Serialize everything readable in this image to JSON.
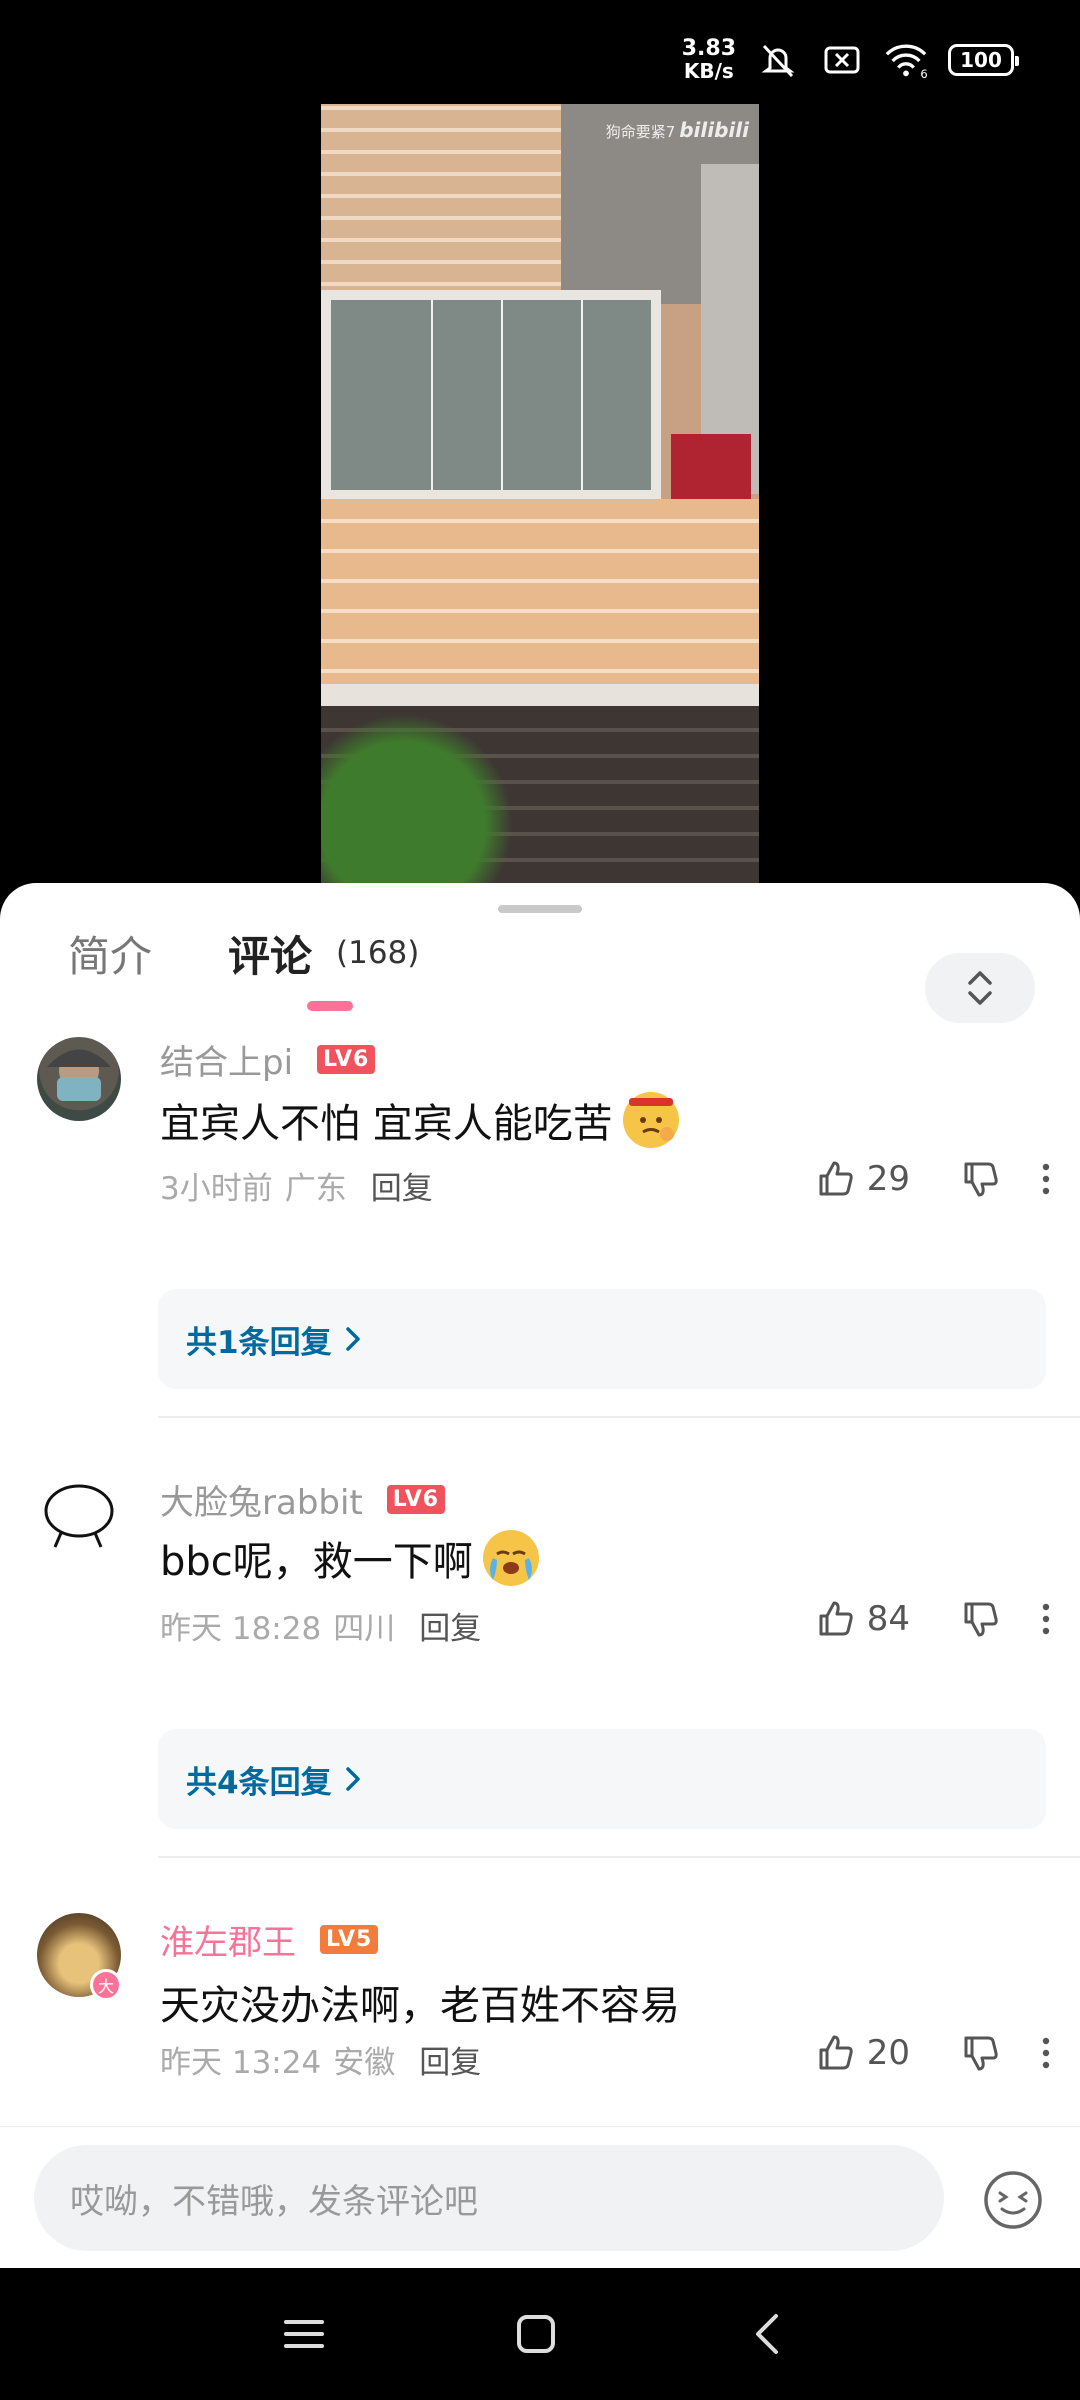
{
  "status_bar": {
    "net_speed_value": "3.83",
    "net_speed_unit": "KB/s",
    "icons": [
      "mute-icon",
      "sim-blocked-icon",
      "wifi-icon",
      "battery-icon"
    ],
    "wifi_label": "6",
    "battery": "100"
  },
  "video": {
    "watermark_text": "狗命要紧7",
    "watermark_logo": "bilibili"
  },
  "tabs": {
    "intro": "简介",
    "comments": "评论",
    "comment_count": "(168)"
  },
  "comments": [
    {
      "user": "结合上pi",
      "level": "LV6",
      "text": "宜宾人不怕 宜宾人能吃苦",
      "emoji": "determined-emoji",
      "time": "3小时前",
      "location": "广东",
      "reply_label": "回复",
      "likes": "29",
      "replies_link": "共1条回复"
    },
    {
      "user": "大脸兔rabbit",
      "level": "LV6",
      "text": "bbc呢，救一下啊",
      "emoji": "crying-emoji",
      "time": "昨天 18:28",
      "location": "四川",
      "reply_label": "回复",
      "likes": "84",
      "replies_link": "共4条回复"
    },
    {
      "user": "淮左郡王",
      "level": "LV5",
      "text": "天灾没办法啊，老百姓不容易",
      "time": "昨天 13:24",
      "location": "安徽",
      "reply_label": "回复",
      "likes": "20",
      "badge": "大"
    }
  ],
  "input": {
    "placeholder": "哎呦，不错哦，发条评论吧"
  },
  "colors": {
    "accent_pink": "#fb7299",
    "link_blue": "#00699d",
    "level_red": "#f0535d",
    "level_orange": "#f27c3c"
  }
}
